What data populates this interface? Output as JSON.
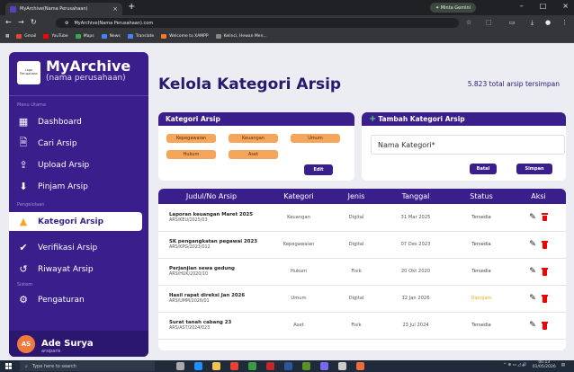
{
  "browser": {
    "tab_title": "MyArchive(Nama Perusahaan)",
    "profile": "Minta Gemini",
    "url": "MyArchive(Nama Perusahaan).com",
    "bookmarks": [
      "Gmail",
      "YouTube",
      "Maps",
      "News",
      "Translate",
      "Welcome to XAMPP",
      "Kelinci, Hewan Men..."
    ]
  },
  "sidebar": {
    "logo_text": "Logo Perusahaan",
    "brand": "MyArchive",
    "brand_sub": "(nama perusahaan)",
    "section_main": "Menu Utama",
    "section_manage": "Pengelolaan",
    "section_system": "Sistem",
    "items": [
      {
        "label": "Dashboard",
        "icon": "dashboard-icon"
      },
      {
        "label": "Cari Arsip",
        "icon": "search-document-icon"
      },
      {
        "label": "Upload Arsip",
        "icon": "upload-file-icon"
      },
      {
        "label": "Pinjam Arsip",
        "icon": "borrow-file-icon"
      },
      {
        "label": "Kategori Arsip",
        "icon": "category-icon"
      },
      {
        "label": "Verifikasi Arsip",
        "icon": "verify-check-icon"
      },
      {
        "label": "Riwayat Arsip",
        "icon": "history-icon"
      },
      {
        "label": "Pengaturan",
        "icon": "gear-icon"
      }
    ],
    "user": {
      "initials": "AS",
      "name": "Ade Surya",
      "role": "arsiparis"
    }
  },
  "header": {
    "title": "Kelola Kategori Arsip",
    "total": "5.823 total arsip tersimpan"
  },
  "categories_card": {
    "title": "Kategori Arsip",
    "chips": [
      "Kepegawaian",
      "Keuangan",
      "Umum",
      "Hukum",
      "Aset"
    ],
    "edit_label": "Edit"
  },
  "add_card": {
    "title": "Tambah Kategori Arsip",
    "placeholder": "Nama Kategori*",
    "cancel_label": "Batal",
    "save_label": "Simpan"
  },
  "table": {
    "headers": [
      "Judul/No Arsip",
      "Kategori",
      "Jenis",
      "Tanggal",
      "Status",
      "Aksi"
    ],
    "rows": [
      {
        "title": "Laporan keuangan Maret 2025",
        "code": "ARS/KEU/2025/03",
        "category": "Keuangan",
        "type": "Digital",
        "date": "31 Mar 2025",
        "status": "Tersedia"
      },
      {
        "title": "SK pengangkatan pegawai 2023",
        "code": "ARS/KPG/2023/012",
        "category": "Kepegawaian",
        "type": "Digital",
        "date": "07 Des 2023",
        "status": "Tersedia"
      },
      {
        "title": "Perjanjian sewa gedung",
        "code": "ARS/HUK/2020/10",
        "category": "Hukum",
        "type": "Fisik",
        "date": "20 Okt 2020",
        "status": "Tersedia"
      },
      {
        "title": "Hasil rapat direksi Jan 2026",
        "code": "ARS/UMM/2026/01",
        "category": "Umum",
        "type": "Digital",
        "date": "12 Jan 2026",
        "status": "Dipinjam"
      },
      {
        "title": "Surat tanah cabang 23",
        "code": "ARS/AST/2024/023",
        "category": "Aset",
        "type": "Fisik",
        "date": "23 Jul 2024",
        "status": "Tersedia"
      }
    ]
  },
  "taskbar": {
    "search_placeholder": "Type here to search",
    "time": "00.13",
    "date": "01/05/2026"
  }
}
